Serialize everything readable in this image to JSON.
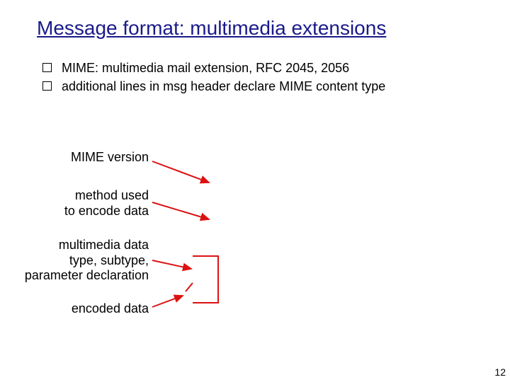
{
  "title": "Message format: multimedia extensions",
  "bullets": [
    "MIME: multimedia mail extension, RFC 2045, 2056",
    "additional lines in msg header declare MIME content type"
  ],
  "labels": {
    "mime_version": "MIME version",
    "method_line1": "method used",
    "method_line2": "to encode data",
    "multi_line1": "multimedia data",
    "multi_line2": "type, subtype,",
    "multi_line3": "parameter declaration",
    "encoded_data": "encoded data"
  },
  "page_number": "12",
  "arrow_color": "#d11"
}
